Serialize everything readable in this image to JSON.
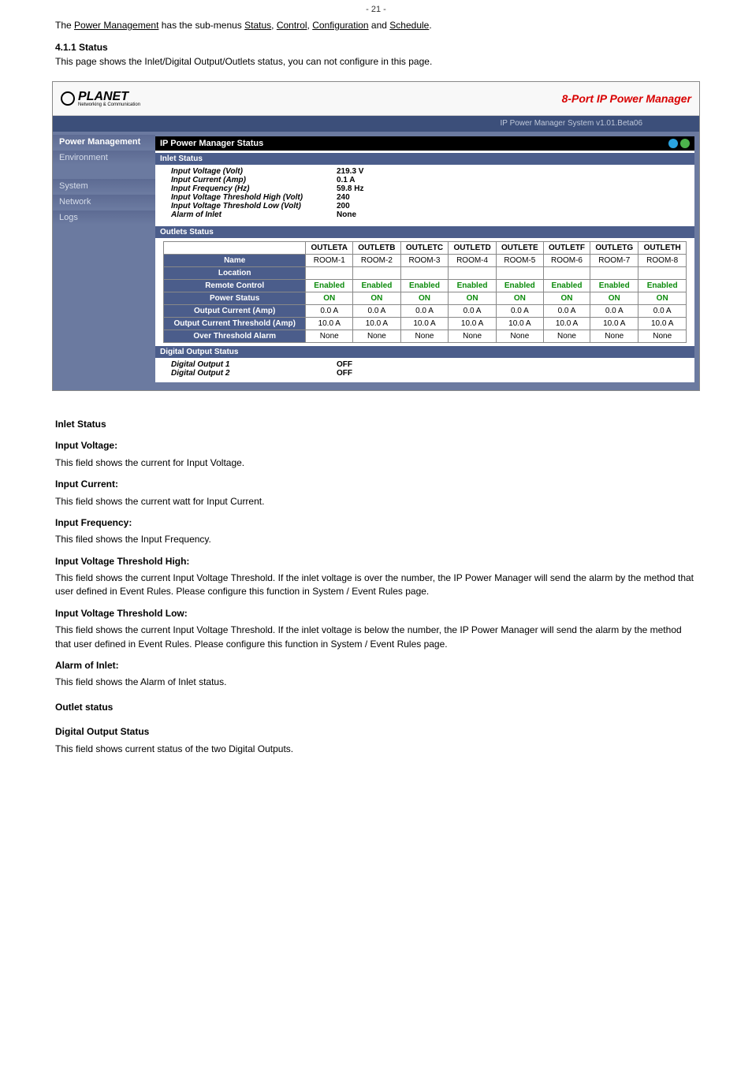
{
  "page_footer": "- 21 -",
  "intro": {
    "t1": "The ",
    "link1": "Power Management",
    "t2": " has the sub-menus ",
    "link2": "Status",
    "t3": ", ",
    "link3": "Control",
    "t4": ", ",
    "link4": "Configuration",
    "t5": " and ",
    "link5": "Schedule",
    "t6": "."
  },
  "s411": {
    "heading": "4.1.1 Status",
    "p": "This page shows the Inlet/Digital Output/Outlets status, you can not configure in this page."
  },
  "header": {
    "logo": "PLANET",
    "logo_sub": "Networking & Communication",
    "title": "8-Port IP Power Manager",
    "topbar": "IP Power Manager System v1.01.Beta06"
  },
  "sidebar": {
    "items": [
      "Power Management",
      "Environment",
      "System",
      "Network",
      "Logs"
    ]
  },
  "content_title": "IP Power Manager Status",
  "inlet": {
    "bar": "Inlet Status",
    "rows": [
      {
        "k": "Input Voltage ",
        "u": "(Volt)",
        "v": "219.3 V"
      },
      {
        "k": "Input Current ",
        "u": "(Amp)",
        "v": "0.1 A"
      },
      {
        "k": "Input Frequency ",
        "u": "(Hz)",
        "v": "59.8 Hz"
      },
      {
        "k": "Input Voltage Threshold High ",
        "u": "(Volt)",
        "v": "240"
      },
      {
        "k": "Input Voltage Threshold Low ",
        "u": "(Volt)",
        "v": "200"
      },
      {
        "k": "Alarm of Inlet",
        "u": "",
        "v": "None"
      }
    ]
  },
  "outlets": {
    "bar": "Outlets Status",
    "cols": [
      "",
      "OUTLETA",
      "OUTLETB",
      "OUTLETC",
      "OUTLETD",
      "OUTLETE",
      "OUTLETF",
      "OUTLETG",
      "OUTLETH"
    ],
    "rows": [
      {
        "h": "Name",
        "c": [
          "ROOM-1",
          "ROOM-2",
          "ROOM-3",
          "ROOM-4",
          "ROOM-5",
          "ROOM-6",
          "ROOM-7",
          "ROOM-8"
        ],
        "cls": ""
      },
      {
        "h": "Location",
        "c": [
          "",
          "",
          "",
          "",
          "",
          "",
          "",
          ""
        ],
        "cls": ""
      },
      {
        "h": "Remote Control",
        "c": [
          "Enabled",
          "Enabled",
          "Enabled",
          "Enabled",
          "Enabled",
          "Enabled",
          "Enabled",
          "Enabled"
        ],
        "cls": "green"
      },
      {
        "h": "Power Status",
        "c": [
          "ON",
          "ON",
          "ON",
          "ON",
          "ON",
          "ON",
          "ON",
          "ON"
        ],
        "cls": "green"
      },
      {
        "h": "Output Current (Amp)",
        "c": [
          "0.0 A",
          "0.0 A",
          "0.0 A",
          "0.0 A",
          "0.0 A",
          "0.0 A",
          "0.0 A",
          "0.0 A"
        ],
        "cls": ""
      },
      {
        "h": "Output Current Threshold (Amp)",
        "c": [
          "10.0 A",
          "10.0 A",
          "10.0 A",
          "10.0 A",
          "10.0 A",
          "10.0 A",
          "10.0 A",
          "10.0 A"
        ],
        "cls": ""
      },
      {
        "h": "Over Threshold Alarm",
        "c": [
          "None",
          "None",
          "None",
          "None",
          "None",
          "None",
          "None",
          "None"
        ],
        "cls": ""
      }
    ]
  },
  "digital": {
    "bar": "Digital Output Status",
    "rows": [
      {
        "k": "Digital Output 1",
        "v": "OFF"
      },
      {
        "k": "Digital Output 2",
        "v": "OFF"
      }
    ]
  },
  "desc": {
    "inlet_h": "Inlet Status",
    "iv_h": "Input Voltage:",
    "iv_p": "This field shows the current for Input Voltage.",
    "ic_h": "Input Current:",
    "ic_p": "This field shows the current watt for Input Current.",
    "if_h": "Input Frequency:",
    "if_p": "This filed shows the Input Frequency.",
    "ivth_h": "Input Voltage Threshold High:",
    "ivth_p": "This field shows the current Input Voltage Threshold. If the inlet voltage is over the number, the IP Power Manager will send the alarm by the method that user defined in Event Rules. Please configure this function in System / Event Rules page.",
    "ivtl_h": "Input Voltage Threshold Low:",
    "ivtl_p": "This field shows the current Input Voltage Threshold. If the inlet voltage is below the number, the IP Power Manager will send the alarm by the method that user defined in Event Rules. Please configure this function in System / Event Rules page.",
    "ai_h": "Alarm of Inlet:",
    "ai_p": "This field shows the Alarm of Inlet status.",
    "outlet_h": "Outlet status",
    "do_h": "Digital Output Status",
    "do_p": "This field shows current status of the two Digital Outputs."
  }
}
